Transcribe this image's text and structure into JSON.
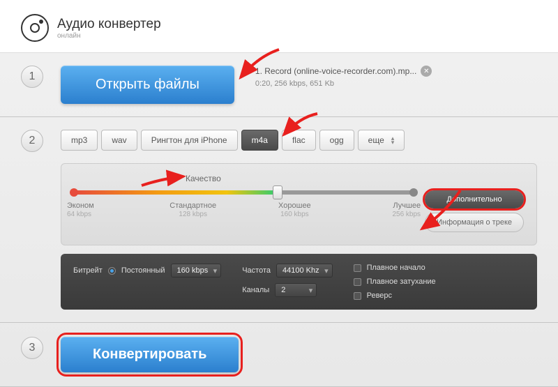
{
  "header": {
    "title": "Аудио конвертер",
    "subtitle": "онлайн"
  },
  "step1": {
    "open_button": "Открыть файлы",
    "file_name": "1. Record (online-voice-recorder.com).mp...",
    "file_meta": "0:20, 256 kbps, 651 Kb"
  },
  "step2": {
    "formats": [
      "mp3",
      "wav",
      "Рингтон для iPhone",
      "m4a",
      "flac",
      "ogg",
      "еще"
    ],
    "active_format_index": 3,
    "quality_label": "Качество",
    "quality_levels": [
      {
        "name": "Эконом",
        "kbps": "64 kbps"
      },
      {
        "name": "Стандартное",
        "kbps": "128 kbps"
      },
      {
        "name": "Хорошее",
        "kbps": "160 kbps"
      },
      {
        "name": "Лучшее",
        "kbps": "256 kbps"
      }
    ],
    "advanced_button": "Дополнительно",
    "track_info_button": "Информация о треке",
    "advanced": {
      "bitrate_label": "Битрейт",
      "bitrate_mode": "Постоянный",
      "bitrate_value": "160 kbps",
      "freq_label": "Частота",
      "freq_value": "44100 Khz",
      "channels_label": "Каналы",
      "channels_value": "2",
      "fade_in": "Плавное начало",
      "fade_out": "Плавное затухание",
      "reverse": "Реверс"
    }
  },
  "step3": {
    "convert_button": "Конвертировать"
  }
}
